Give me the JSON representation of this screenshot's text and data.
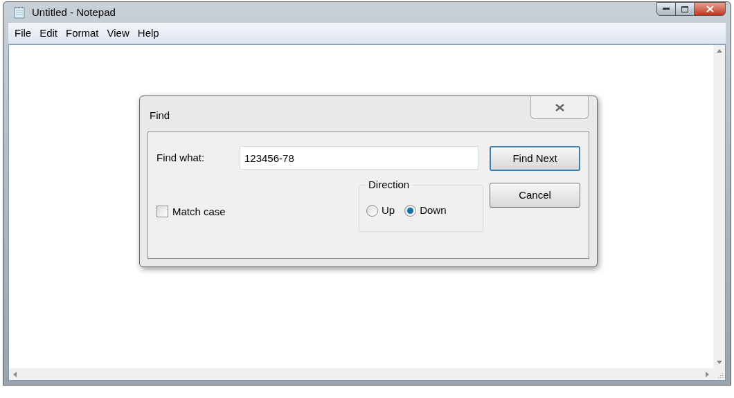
{
  "window": {
    "title": "Untitled - Notepad"
  },
  "menu": [
    "File",
    "Edit",
    "Format",
    "View",
    "Help"
  ],
  "dialog": {
    "title": "Find",
    "find_what": {
      "label": "Find what:",
      "value": "123456-78"
    },
    "match_case": {
      "label": "Match case",
      "checked": false
    },
    "direction": {
      "label": "Direction",
      "options": [
        {
          "label": "Up",
          "selected": false
        },
        {
          "label": "Down",
          "selected": true
        }
      ]
    },
    "buttons": [
      {
        "label": "Find Next",
        "default": true
      },
      {
        "label": "Cancel",
        "default": false
      }
    ]
  }
}
